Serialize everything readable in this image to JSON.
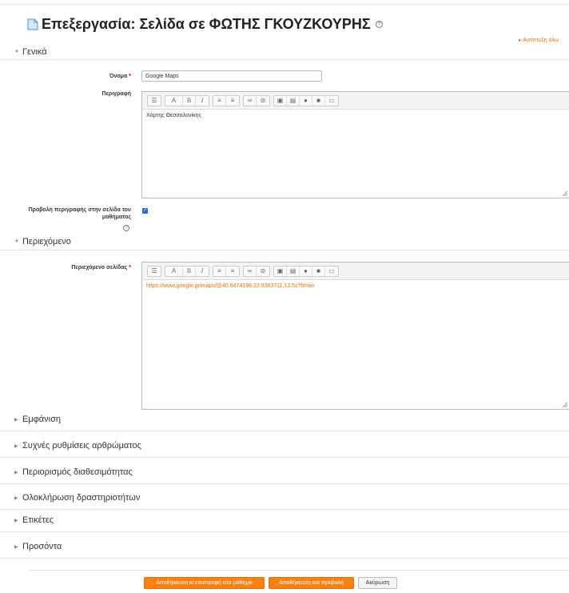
{
  "header": {
    "title": "Επεξεργασία: Σελίδα σε ΦΩΤΗΣ ΓΚΟΥΖΚΟΥΡΗΣ",
    "help_symbol": "?",
    "expand_all": "▸ Ανάπτυξη όλω"
  },
  "sections": {
    "general": "Γενικά",
    "content": "Περιεχόμενο",
    "appearance": "Εμφάνιση",
    "module_settings": "Συχνές ρυθμίσεις αρθρώματος",
    "restrict": "Περιορισμός διαθεσιμότητας",
    "completion": "Ολοκλήρωση δραστηριοτήτων",
    "tags": "Ετικέτες",
    "competencies": "Προσόντα"
  },
  "fields": {
    "name_label": "Όνομα",
    "required_mark": "*",
    "name_value": "Google Maps",
    "description_label": "Περιγραφή",
    "description_text": "Χάρτης Θεσσαλονίκης",
    "show_description_label": "Προβολή περιγραφής στην σελίδα του μαθήματος",
    "page_content_label": "Περιεχόμενο σελίδας",
    "page_content_text": "https://www.google.gr/maps/@40.6474198,22.9383711,13.5z?hl=en"
  },
  "toolbar": {
    "font": "A",
    "bold": "B",
    "italic": "I"
  },
  "buttons": {
    "save_return": "Αποθήκευση κι επιστροφή στο μάθημα",
    "save_display": "Αποθήκευση και προβολή",
    "cancel": "Ακύρωση"
  },
  "colors": {
    "accent": "#f98012",
    "link": "#e8730e",
    "checkbox": "#2b6cc9",
    "required": "#cc0000"
  }
}
